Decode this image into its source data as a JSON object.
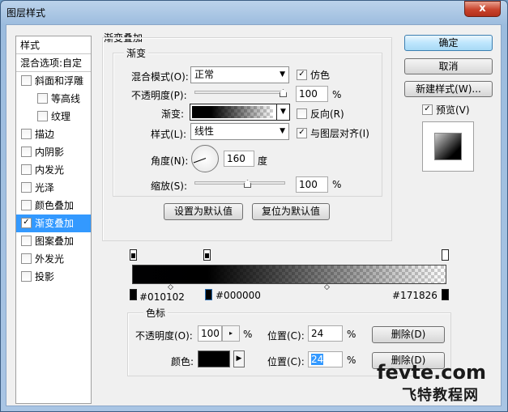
{
  "window": {
    "title": "图层样式",
    "close_label": "x"
  },
  "sidebar": {
    "header": "样式",
    "blend_options": "混合选项:自定",
    "items": [
      {
        "label": "斜面和浮雕",
        "checked": false
      },
      {
        "label": "等高线",
        "checked": false
      },
      {
        "label": "纹理",
        "checked": false
      },
      {
        "label": "描边",
        "checked": false
      },
      {
        "label": "内阴影",
        "checked": false
      },
      {
        "label": "内发光",
        "checked": false
      },
      {
        "label": "光泽",
        "checked": false
      },
      {
        "label": "颜色叠加",
        "checked": false
      },
      {
        "label": "渐变叠加",
        "checked": true
      },
      {
        "label": "图案叠加",
        "checked": false
      },
      {
        "label": "外发光",
        "checked": false
      },
      {
        "label": "投影",
        "checked": false
      }
    ]
  },
  "panel": {
    "section_title": "渐变叠加",
    "group_title": "渐变",
    "blend_mode_label": "混合模式(O):",
    "blend_mode_value": "正常",
    "dither_label": "仿色",
    "dither_checked": true,
    "opacity_label": "不透明度(P):",
    "opacity_value": "100",
    "opacity_unit": "%",
    "gradient_label": "渐变:",
    "reverse_label": "反向(R)",
    "reverse_checked": false,
    "style_label": "样式(L):",
    "style_value": "线性",
    "align_label": "与图层对齐(I)",
    "align_checked": true,
    "angle_label": "角度(N):",
    "angle_value": "160",
    "angle_unit": "度",
    "scale_label": "缩放(S):",
    "scale_value": "100",
    "scale_unit": "%",
    "set_default": "设置为默认值",
    "reset_default": "复位为默认值"
  },
  "buttons": {
    "ok": "确定",
    "cancel": "取消",
    "new_style": "新建样式(W)...",
    "preview_label": "预览(V)",
    "preview_checked": true
  },
  "gradient_editor": {
    "stop_labels": [
      "#010102",
      "#000000",
      "#171826"
    ],
    "color_stop_title": "色标",
    "opacity_label": "不透明度(O):",
    "opacity_value": "100",
    "opacity_unit": "%",
    "position_label": "位置(C):",
    "position1_value": "24",
    "position2_value": "24",
    "position_unit": "%",
    "delete_label": "删除(D)",
    "color_label": "颜色:"
  },
  "watermark": {
    "line1": "fevte.com",
    "line2": "飞特教程网"
  }
}
